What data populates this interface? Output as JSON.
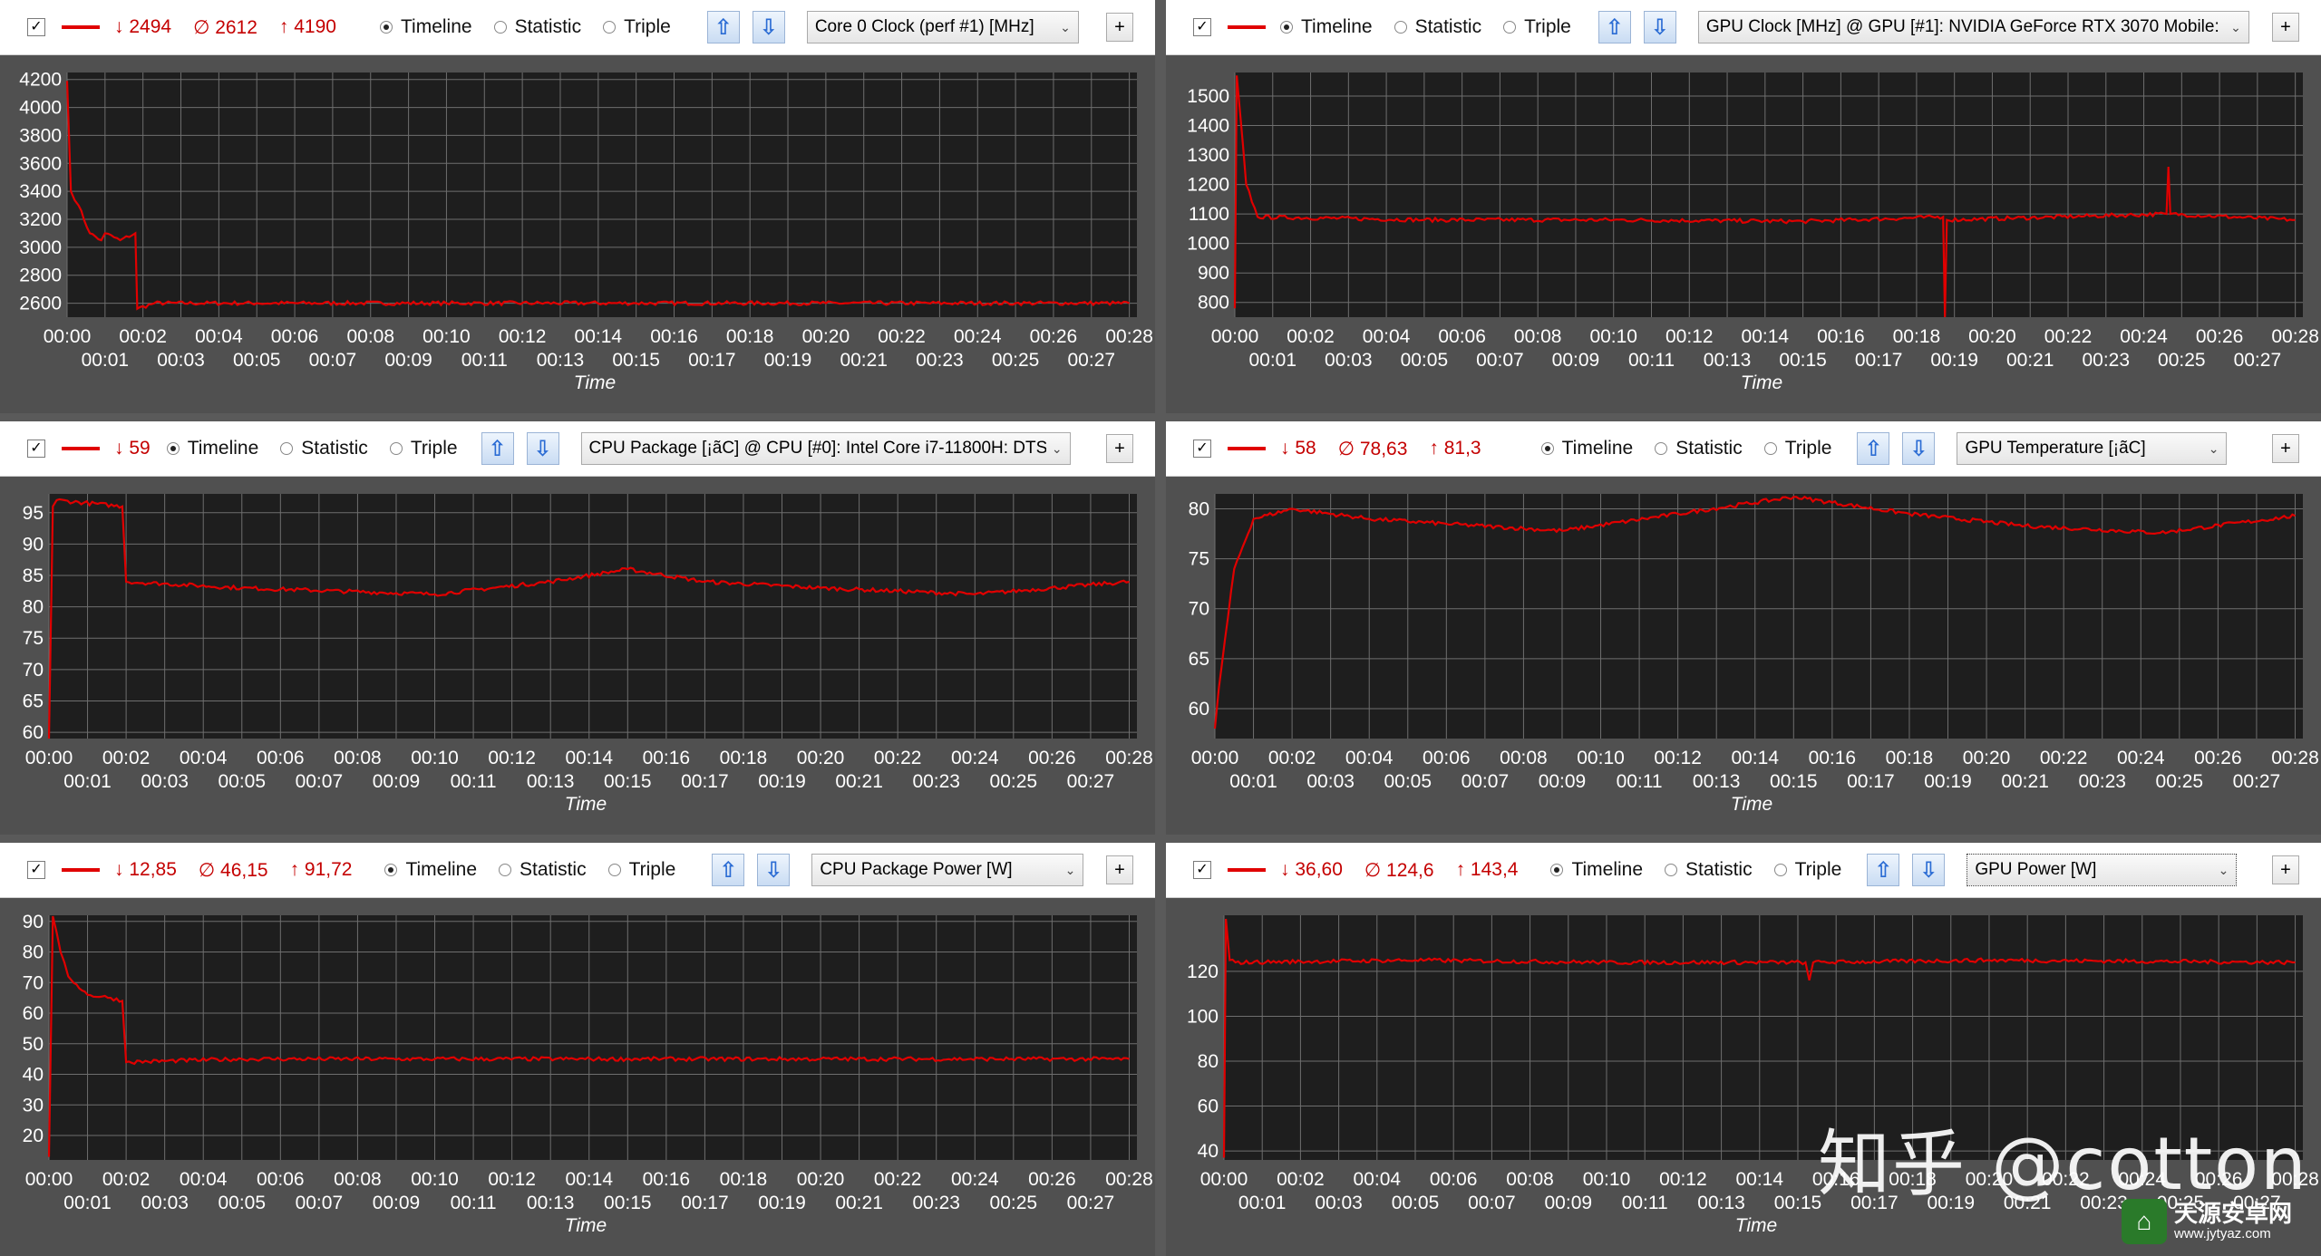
{
  "panels": [
    {
      "id": "p0",
      "stats": {
        "min": "↓ 2494",
        "avg": "∅ 2612",
        "max": "↑ 4190"
      },
      "modes": [
        "Timeline",
        "Statistic",
        "Triple"
      ],
      "active_mode": "Timeline",
      "sensor": "Core 0 Clock (perf #1) [MHz]",
      "ylabels": [
        "4200",
        "4000",
        "3800",
        "3600",
        "3400",
        "3200",
        "3000",
        "2800",
        "2600"
      ],
      "xlabels_top": [
        "00:00",
        "00:02",
        "00:04",
        "00:06",
        "00:08",
        "00:10",
        "00:12",
        "00:14",
        "00:16",
        "00:18",
        "00:20",
        "00:22",
        "00:24",
        "00:26",
        "00:28"
      ],
      "xlabels_bottom": [
        "00:01",
        "00:03",
        "00:05",
        "00:07",
        "00:09",
        "00:11",
        "00:13",
        "00:15",
        "00:17",
        "00:19",
        "00:21",
        "00:23",
        "00:25",
        "00:27"
      ],
      "xtitle": "Time"
    },
    {
      "id": "p1",
      "stats": null,
      "modes": [
        "Timeline",
        "Statistic",
        "Triple"
      ],
      "active_mode": "Timeline",
      "sensor": "GPU Clock [MHz] @ GPU [#1]: NVIDIA GeForce RTX 3070 Mobile:",
      "ylabels": [
        "1500",
        "1400",
        "1300",
        "1200",
        "1100",
        "1000",
        "900",
        "800"
      ],
      "xlabels_top": [
        "00:00",
        "00:02",
        "00:04",
        "00:06",
        "00:08",
        "00:10",
        "00:12",
        "00:14",
        "00:16",
        "00:18",
        "00:20",
        "00:22",
        "00:24",
        "00:26",
        "00:28"
      ],
      "xlabels_bottom": [
        "00:01",
        "00:03",
        "00:05",
        "00:07",
        "00:09",
        "00:11",
        "00:13",
        "00:15",
        "00:17",
        "00:19",
        "00:21",
        "00:23",
        "00:25",
        "00:27"
      ],
      "xtitle": "Time"
    },
    {
      "id": "p2",
      "stats": {
        "min": "↓ 59",
        "avg": "",
        "max": ""
      },
      "modes": [
        "Timeline",
        "Statistic",
        "Triple"
      ],
      "active_mode": "Timeline",
      "sensor": "CPU Package [¡ãC] @ CPU [#0]: Intel Core i7-11800H: DTS",
      "ylabels": [
        "95",
        "90",
        "85",
        "80",
        "75",
        "70",
        "65",
        "60"
      ],
      "xlabels_top": [
        "00:00",
        "00:02",
        "00:04",
        "00:06",
        "00:08",
        "00:10",
        "00:12",
        "00:14",
        "00:16",
        "00:18",
        "00:20",
        "00:22",
        "00:24",
        "00:26",
        "00:28"
      ],
      "xlabels_bottom": [
        "00:01",
        "00:03",
        "00:05",
        "00:07",
        "00:09",
        "00:11",
        "00:13",
        "00:15",
        "00:17",
        "00:19",
        "00:21",
        "00:23",
        "00:25",
        "00:27"
      ],
      "xtitle": "Time"
    },
    {
      "id": "p3",
      "stats": {
        "min": "↓ 58",
        "avg": "∅ 78,63",
        "max": "↑ 81,3"
      },
      "modes": [
        "Timeline",
        "Statistic",
        "Triple"
      ],
      "active_mode": "Timeline",
      "sensor": "GPU Temperature [¡ãC]",
      "ylabels": [
        "80",
        "75",
        "70",
        "65",
        "60"
      ],
      "xlabels_top": [
        "00:00",
        "00:02",
        "00:04",
        "00:06",
        "00:08",
        "00:10",
        "00:12",
        "00:14",
        "00:16",
        "00:18",
        "00:20",
        "00:22",
        "00:24",
        "00:26",
        "00:28"
      ],
      "xlabels_bottom": [
        "00:01",
        "00:03",
        "00:05",
        "00:07",
        "00:09",
        "00:11",
        "00:13",
        "00:15",
        "00:17",
        "00:19",
        "00:21",
        "00:23",
        "00:25",
        "00:27"
      ],
      "xtitle": "Time"
    },
    {
      "id": "p4",
      "stats": {
        "min": "↓ 12,85",
        "avg": "∅ 46,15",
        "max": "↑ 91,72"
      },
      "modes": [
        "Timeline",
        "Statistic",
        "Triple"
      ],
      "active_mode": "Timeline",
      "sensor": "CPU Package Power [W]",
      "ylabels": [
        "90",
        "80",
        "70",
        "60",
        "50",
        "40",
        "30",
        "20"
      ],
      "xlabels_top": [
        "00:00",
        "00:02",
        "00:04",
        "00:06",
        "00:08",
        "00:10",
        "00:12",
        "00:14",
        "00:16",
        "00:18",
        "00:20",
        "00:22",
        "00:24",
        "00:26",
        "00:28"
      ],
      "xlabels_bottom": [
        "00:01",
        "00:03",
        "00:05",
        "00:07",
        "00:09",
        "00:11",
        "00:13",
        "00:15",
        "00:17",
        "00:19",
        "00:21",
        "00:23",
        "00:25",
        "00:27"
      ],
      "xtitle": "Time"
    },
    {
      "id": "p5",
      "stats": {
        "min": "↓ 36,60",
        "avg": "∅ 124,6",
        "max": "↑ 143,4"
      },
      "modes": [
        "Timeline",
        "Statistic",
        "Triple"
      ],
      "active_mode": "Timeline",
      "sensor": "GPU Power [W]",
      "ylabels": [
        "120",
        "100",
        "80",
        "60",
        "40"
      ],
      "xlabels_top": [
        "00:00",
        "00:02",
        "00:04",
        "00:06",
        "00:08",
        "00:10",
        "00:12",
        "00:14",
        "00:16",
        "00:18",
        "00:20",
        "00:22",
        "00:24",
        "00:26",
        "00:28"
      ],
      "xlabels_bottom": [
        "00:01",
        "00:03",
        "00:05",
        "00:07",
        "00:09",
        "00:11",
        "00:13",
        "00:15",
        "00:17",
        "00:19",
        "00:21",
        "00:23",
        "00:25",
        "00:27"
      ],
      "xtitle": "Time"
    }
  ],
  "chart_data": [
    {
      "type": "line",
      "title": "Core 0 Clock (perf #1) [MHz]",
      "xlabel": "Time",
      "ylabel": "",
      "ylim": [
        2500,
        4250
      ],
      "xlim": [
        "00:00",
        "00:28"
      ],
      "grid": true,
      "series": [
        {
          "name": "Core 0 Clock (perf #1) [MHz]",
          "color": "#e00000",
          "x": [
            "00:00",
            "00:00.1",
            "00:00.3",
            "00:00.6",
            "00:00.9",
            "00:01.0",
            "00:01.4",
            "00:01.8",
            "00:01.85",
            "00:02.3",
            "00:05",
            "00:10",
            "00:15",
            "00:20",
            "00:25",
            "00:28"
          ],
          "y": [
            4190,
            3400,
            3300,
            3100,
            3050,
            3100,
            3050,
            3100,
            2560,
            2600,
            2600,
            2600,
            2600,
            2600,
            2600,
            2600
          ]
        }
      ]
    },
    {
      "type": "line",
      "title": "GPU Clock [MHz] @ GPU [#1]: NVIDIA GeForce RTX 3070 Mobile:",
      "xlabel": "Time",
      "ylabel": "",
      "ylim": [
        750,
        1580
      ],
      "xlim": [
        "00:00",
        "00:28"
      ],
      "grid": true,
      "series": [
        {
          "name": "GPU Clock",
          "color": "#e00000",
          "x": [
            "00:00",
            "00:00.05",
            "00:00.3",
            "00:00.6",
            "00:05",
            "00:10",
            "00:15",
            "00:18.7",
            "00:18.75",
            "00:18.8",
            "00:24.6",
            "00:24.65",
            "00:24.7",
            "00:28"
          ],
          "y": [
            780,
            1570,
            1200,
            1090,
            1080,
            1080,
            1075,
            1090,
            750,
            1080,
            1100,
            1260,
            1100,
            1080
          ]
        }
      ]
    },
    {
      "type": "line",
      "title": "CPU Package [¡ãC] @ CPU [#0]: Intel Core i7-11800H: DTS",
      "xlabel": "Time",
      "ylabel": "",
      "ylim": [
        59,
        98
      ],
      "xlim": [
        "00:00",
        "00:28"
      ],
      "grid": true,
      "series": [
        {
          "name": "CPU Package",
          "color": "#e00000",
          "x": [
            "00:00",
            "00:00.1",
            "00:00.2",
            "00:01.9",
            "00:02.0",
            "00:05",
            "00:10",
            "00:13",
            "00:15",
            "00:17",
            "00:20",
            "00:24",
            "00:28"
          ],
          "y": [
            59,
            96,
            97,
            96,
            84,
            83,
            82,
            84,
            86,
            84,
            83,
            82,
            84
          ]
        }
      ]
    },
    {
      "type": "line",
      "title": "GPU Temperature [¡ãC]",
      "xlabel": "Time",
      "ylabel": "",
      "ylim": [
        57,
        81.5
      ],
      "xlim": [
        "00:00",
        "00:28"
      ],
      "grid": true,
      "series": [
        {
          "name": "GPU Temperature",
          "color": "#e00000",
          "x": [
            "00:00",
            "00:00.1",
            "00:00.5",
            "00:01",
            "00:02",
            "00:04",
            "00:06",
            "00:09",
            "00:12",
            "00:15",
            "00:18",
            "00:21",
            "00:24.5",
            "00:28"
          ],
          "y": [
            58,
            62,
            74,
            79,
            80,
            79,
            78.5,
            77.8,
            79.5,
            81.2,
            79.5,
            78.3,
            77.6,
            79.3
          ]
        }
      ]
    },
    {
      "type": "line",
      "title": "CPU Package Power [W]",
      "xlabel": "Time",
      "ylabel": "",
      "ylim": [
        12,
        92
      ],
      "xlim": [
        "00:00",
        "00:28"
      ],
      "grid": true,
      "series": [
        {
          "name": "CPU Package Power",
          "color": "#e00000",
          "x": [
            "00:00",
            "00:00.1",
            "00:00.3",
            "00:00.5",
            "00:01",
            "00:01.6",
            "00:01.9",
            "00:02.0",
            "00:05",
            "00:10",
            "00:20",
            "00:28"
          ],
          "y": [
            13,
            91.7,
            80,
            72,
            66,
            65,
            64,
            44,
            45,
            45,
            45,
            45
          ]
        }
      ]
    },
    {
      "type": "line",
      "title": "GPU Power [W]",
      "xlabel": "Time",
      "ylabel": "",
      "ylim": [
        36,
        145
      ],
      "xlim": [
        "00:00",
        "00:28"
      ],
      "grid": true,
      "series": [
        {
          "name": "GPU Power",
          "color": "#e00000",
          "x": [
            "00:00",
            "00:00.05",
            "00:00.15",
            "00:00.3",
            "00:05",
            "00:10",
            "00:15.2",
            "00:15.3",
            "00:15.4",
            "00:20",
            "00:28"
          ],
          "y": [
            37,
            143.4,
            125,
            124,
            125,
            124,
            124,
            116,
            124,
            125,
            124
          ]
        }
      ]
    }
  ],
  "watermark": "知乎 @cotton",
  "site_badge": {
    "name": "天源安卓网",
    "url": "www.jytyaz.com"
  },
  "colors": {
    "line": "#e00000",
    "plot_bg": "#1e1e1e",
    "grid": "#6e6e6e",
    "panel_bg": "#505050",
    "stat_text": "#c40000"
  }
}
